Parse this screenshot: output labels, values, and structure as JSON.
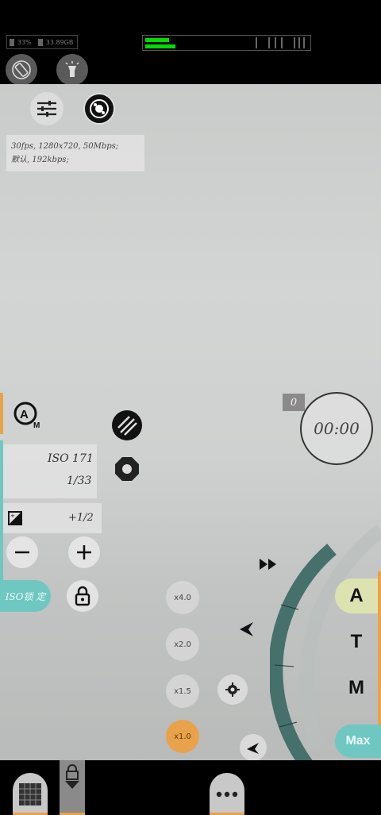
{
  "status": {
    "battery": "33%",
    "storage": "33.89GB"
  },
  "info": {
    "line1": "30fps, 1280x720, 50Mbps;",
    "line2": "默认, 192kbps;"
  },
  "exposure": {
    "iso": "ISO 171",
    "shutter": "1/33",
    "ev": "+1/2"
  },
  "iso_priority_label": "ISO锁 定",
  "counter": "0",
  "timer": "00:00",
  "zoom_levels": [
    "x4.0",
    "x2.0",
    "x1.5",
    "x1.0"
  ],
  "modes": [
    "A",
    "T",
    "M"
  ],
  "max_label": "Max",
  "colors": {
    "accent_orange": "#e8a24a",
    "accent_teal": "#6fc7c2",
    "dial_teal": "#3f6b66",
    "mode_a_bg": "#dde3b0",
    "level_green": "#00dd00"
  }
}
